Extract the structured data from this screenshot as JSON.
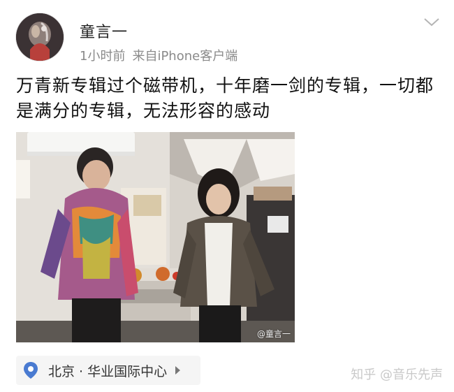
{
  "post": {
    "author": "童言一",
    "time": "1小时前",
    "source": "来自iPhone客户端",
    "text": "万青新专辑过个磁带机，十年磨一剑的专辑，一切都是满分的专辑，无法形容的感动",
    "photo_watermark": "@童言一"
  },
  "location": {
    "label": "北京 · 华业国际中心"
  },
  "watermark": "知乎 @音乐先声",
  "icons": {
    "menu": "chevron-down-icon",
    "location": "location-pin-icon",
    "arrow": "chevron-right-icon"
  },
  "colors": {
    "location_pin": "#4a7bd1",
    "meta_text": "#8a8a8a"
  }
}
